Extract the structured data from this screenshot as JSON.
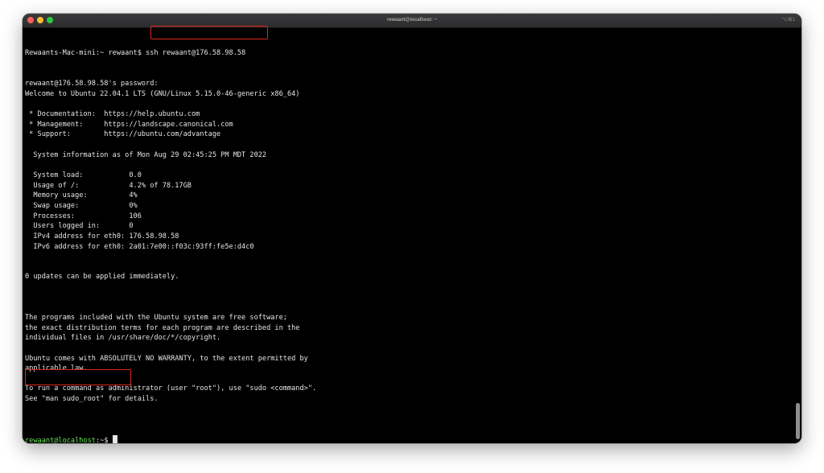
{
  "window": {
    "title": "rewaant@localhost: ~",
    "shortcut": "⌥⌘1"
  },
  "terminal": {
    "first_prompt": "Rewaants-Mac-mini:~ rewaant$",
    "command": "ssh rewaant@176.58.98.58",
    "lines": [
      "rewaant@176.58.98.58's password:",
      "Welcome to Ubuntu 22.04.1 LTS (GNU/Linux 5.15.0-46-generic x86_64)",
      "",
      " * Documentation:  https://help.ubuntu.com",
      " * Management:     https://landscape.canonical.com",
      " * Support:        https://ubuntu.com/advantage",
      "",
      "  System information as of Mon Aug 29 02:45:25 PM MDT 2022",
      "",
      "  System load:           0.0",
      "  Usage of /:            4.2% of 78.17GB",
      "  Memory usage:          4%",
      "  Swap usage:            0%",
      "  Processes:             106",
      "  Users logged in:       0",
      "  IPv4 address for eth0: 176.58.98.58",
      "  IPv6 address for eth0: 2a01:7e00::f03c:93ff:fe5e:d4c0",
      "",
      "",
      "0 updates can be applied immediately.",
      "",
      "",
      "",
      "The programs included with the Ubuntu system are free software;",
      "the exact distribution terms for each program are described in the",
      "individual files in /usr/share/doc/*/copyright.",
      "",
      "Ubuntu comes with ABSOLUTELY NO WARRANTY, to the extent permitted by",
      "applicable law.",
      "",
      "To run a command as administrator (user \"root\"), use \"sudo <command>\".",
      "See \"man sudo_root\" for details.",
      ""
    ],
    "final_prompt_user": "rewaant@localhost",
    "final_prompt_rest": ":~$ "
  },
  "colors": {
    "background": "#000000",
    "text": "#e6e6e6",
    "prompt_user": "#6be25b",
    "highlight_box": "#e0261b"
  }
}
